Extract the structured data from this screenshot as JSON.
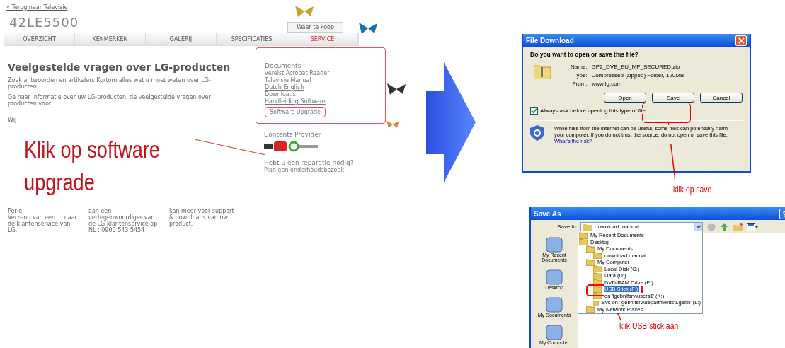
{
  "web_page": {
    "back_link": "« Terug naar Televisie",
    "model": "42LE5500",
    "where_to_buy": "Waar te koop",
    "tabs": [
      {
        "label": "OVERZICHT",
        "selected": false
      },
      {
        "label": "KENMERKEN",
        "selected": false
      },
      {
        "label": "GALERIJ",
        "selected": false
      },
      {
        "label": "SPECIFICATIES",
        "selected": false
      },
      {
        "label": "SERVICE",
        "selected": true
      }
    ],
    "heading": "Veelgestelde vragen over LG-producten",
    "intro": "Zoek antwoorden en artikelen. Kortom alles wat u moet weten over LG-producten.",
    "goto_text": "Ga naar Informatie over uw LG-producten, de veelgestelde vragen over producten voor",
    "cut_word": "Wij",
    "bottom_columns": [
      {
        "link": "Per e",
        "text": "Verzenu van een ... naar de klantenservice van LG."
      },
      {
        "text": "aan een vertegenwoordiger van de LG-klantenservice op NL : 0900 543 5454"
      },
      {
        "text": "kan meer voor support & downloads van uw product."
      }
    ],
    "sidebar": {
      "documents_title": "Documents",
      "documents_note": "vereist Acrobat Reader",
      "manual": "Televisie Manual",
      "languages": "Dutch English",
      "downloads": "Downloads",
      "handleiding": "Handleiding Software",
      "upgrade": "Software Upgrade",
      "provider_title": "Contents Provider",
      "repair_title": "Hebt u een reparatie nodig?",
      "repair_link": "Plan een onderhoudsbezoek."
    }
  },
  "annotation_left": "Klik op software upgrade",
  "file_download": {
    "title": "File Download",
    "question": "Do you want to open or save this file?",
    "fields": [
      {
        "label": "Name:",
        "value": "GP2_DVB_EU_MP_SECURED.zip"
      },
      {
        "label": "Type:",
        "value": "Compressed (zipped) Folder, 120MB"
      },
      {
        "label": "From:",
        "value": "www.lg.com"
      }
    ],
    "buttons": [
      "Open",
      "Save",
      "Cancel"
    ],
    "always_ask": {
      "label": "Always ask before opening this type of file",
      "checked": true
    },
    "warning": "While files from the Internet can be useful, some files can potentially harm your computer. If you do not trust the source, do not open or save this file.",
    "risk_link": "What's the risk?"
  },
  "annotation_save": "klik op save",
  "save_as": {
    "title": "Save As",
    "save_in_label": "Save in:",
    "save_in_value": "download manual",
    "places": [
      "My Recent Documents",
      "Desktop",
      "My Documents",
      "My Computer"
    ],
    "locations": [
      {
        "label": "My Recent Documents",
        "selected": false
      },
      {
        "label": "Desktop",
        "selected": false,
        "children": [
          {
            "label": "My Documents",
            "selected": false,
            "children": [
              {
                "label": "download manual",
                "selected": false
              }
            ]
          },
          {
            "label": "My Computer",
            "selected": false,
            "children": [
              {
                "label": "Local Disk (C:)",
                "selected": false
              },
              {
                "label": "Data (D:)",
                "selected": false
              },
              {
                "label": "DVD-RAM Drive (E:)",
                "selected": false
              },
              {
                "label": "USB Stick (F:)",
                "selected": true
              },
              {
                "label": "on 'lgebnlfsrv\\users$' (K:)",
                "selected": false
              },
              {
                "label": "Svc on 'lgebnlfsrv\\departments\\Lgebn' (L:)",
                "selected": false
              }
            ]
          },
          {
            "label": "My Network Places",
            "selected": false
          }
        ]
      }
    ]
  },
  "annotation_usb": "klik USB stick aan"
}
